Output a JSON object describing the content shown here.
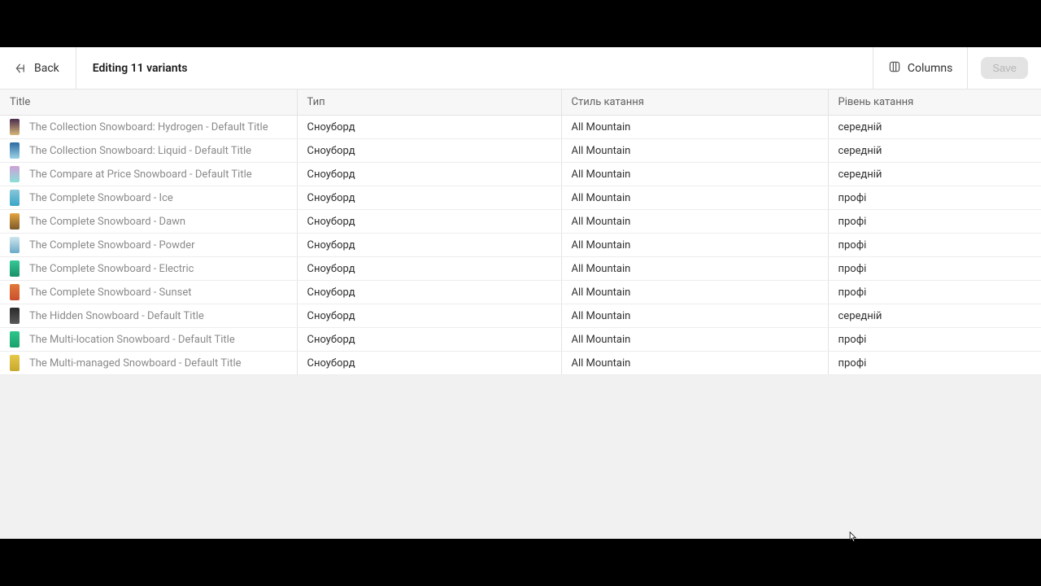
{
  "header": {
    "back_label": "Back",
    "page_title": "Editing 11 variants",
    "columns_label": "Columns",
    "save_label": "Save"
  },
  "columns": {
    "title": "Title",
    "type": "Тип",
    "style": "Стиль катання",
    "level": "Рівень катання"
  },
  "rows": [
    {
      "title": "The Collection Snowboard: Hydrogen - Default Title",
      "thumb_colors": [
        "#4a2d4e",
        "#d7b67a"
      ],
      "type": "Сноуборд",
      "style": "All Mountain",
      "level": "середній"
    },
    {
      "title": "The Collection Snowboard: Liquid - Default Title",
      "thumb_colors": [
        "#2b6aa3",
        "#9dd3e6"
      ],
      "type": "Сноуборд",
      "style": "All Mountain",
      "level": "середній"
    },
    {
      "title": "The Compare at Price Snowboard - Default Title",
      "thumb_colors": [
        "#cfa0d6",
        "#89e0d9"
      ],
      "type": "Сноуборд",
      "style": "All Mountain",
      "level": "середній"
    },
    {
      "title": "The Complete Snowboard - Ice",
      "thumb_colors": [
        "#88c6d9",
        "#3aa7c7"
      ],
      "type": "Сноуборд",
      "style": "All Mountain",
      "level": "профі"
    },
    {
      "title": "The Complete Snowboard - Dawn",
      "thumb_colors": [
        "#e6a340",
        "#7a5a2a"
      ],
      "type": "Сноуборд",
      "style": "All Mountain",
      "level": "профі"
    },
    {
      "title": "The Complete Snowboard - Powder",
      "thumb_colors": [
        "#cfe6ef",
        "#6aa9c7"
      ],
      "type": "Сноуборд",
      "style": "All Mountain",
      "level": "профі"
    },
    {
      "title": "The Complete Snowboard - Electric",
      "thumb_colors": [
        "#35c996",
        "#1a8f68"
      ],
      "type": "Сноуборд",
      "style": "All Mountain",
      "level": "профі"
    },
    {
      "title": "The Complete Snowboard - Sunset",
      "thumb_colors": [
        "#e27a3a",
        "#c94f2d"
      ],
      "type": "Сноуборд",
      "style": "All Mountain",
      "level": "профі"
    },
    {
      "title": "The Hidden Snowboard - Default Title",
      "thumb_colors": [
        "#2a2a2a",
        "#5a5a5a"
      ],
      "type": "Сноуборд",
      "style": "All Mountain",
      "level": "середній"
    },
    {
      "title": "The Multi-location Snowboard - Default Title",
      "thumb_colors": [
        "#2dc78b",
        "#1aa06b"
      ],
      "type": "Сноуборд",
      "style": "All Mountain",
      "level": "профі"
    },
    {
      "title": "The Multi-managed Snowboard - Default Title",
      "thumb_colors": [
        "#e6c84a",
        "#c7a92d"
      ],
      "type": "Сноуборд",
      "style": "All Mountain",
      "level": "профі"
    }
  ]
}
